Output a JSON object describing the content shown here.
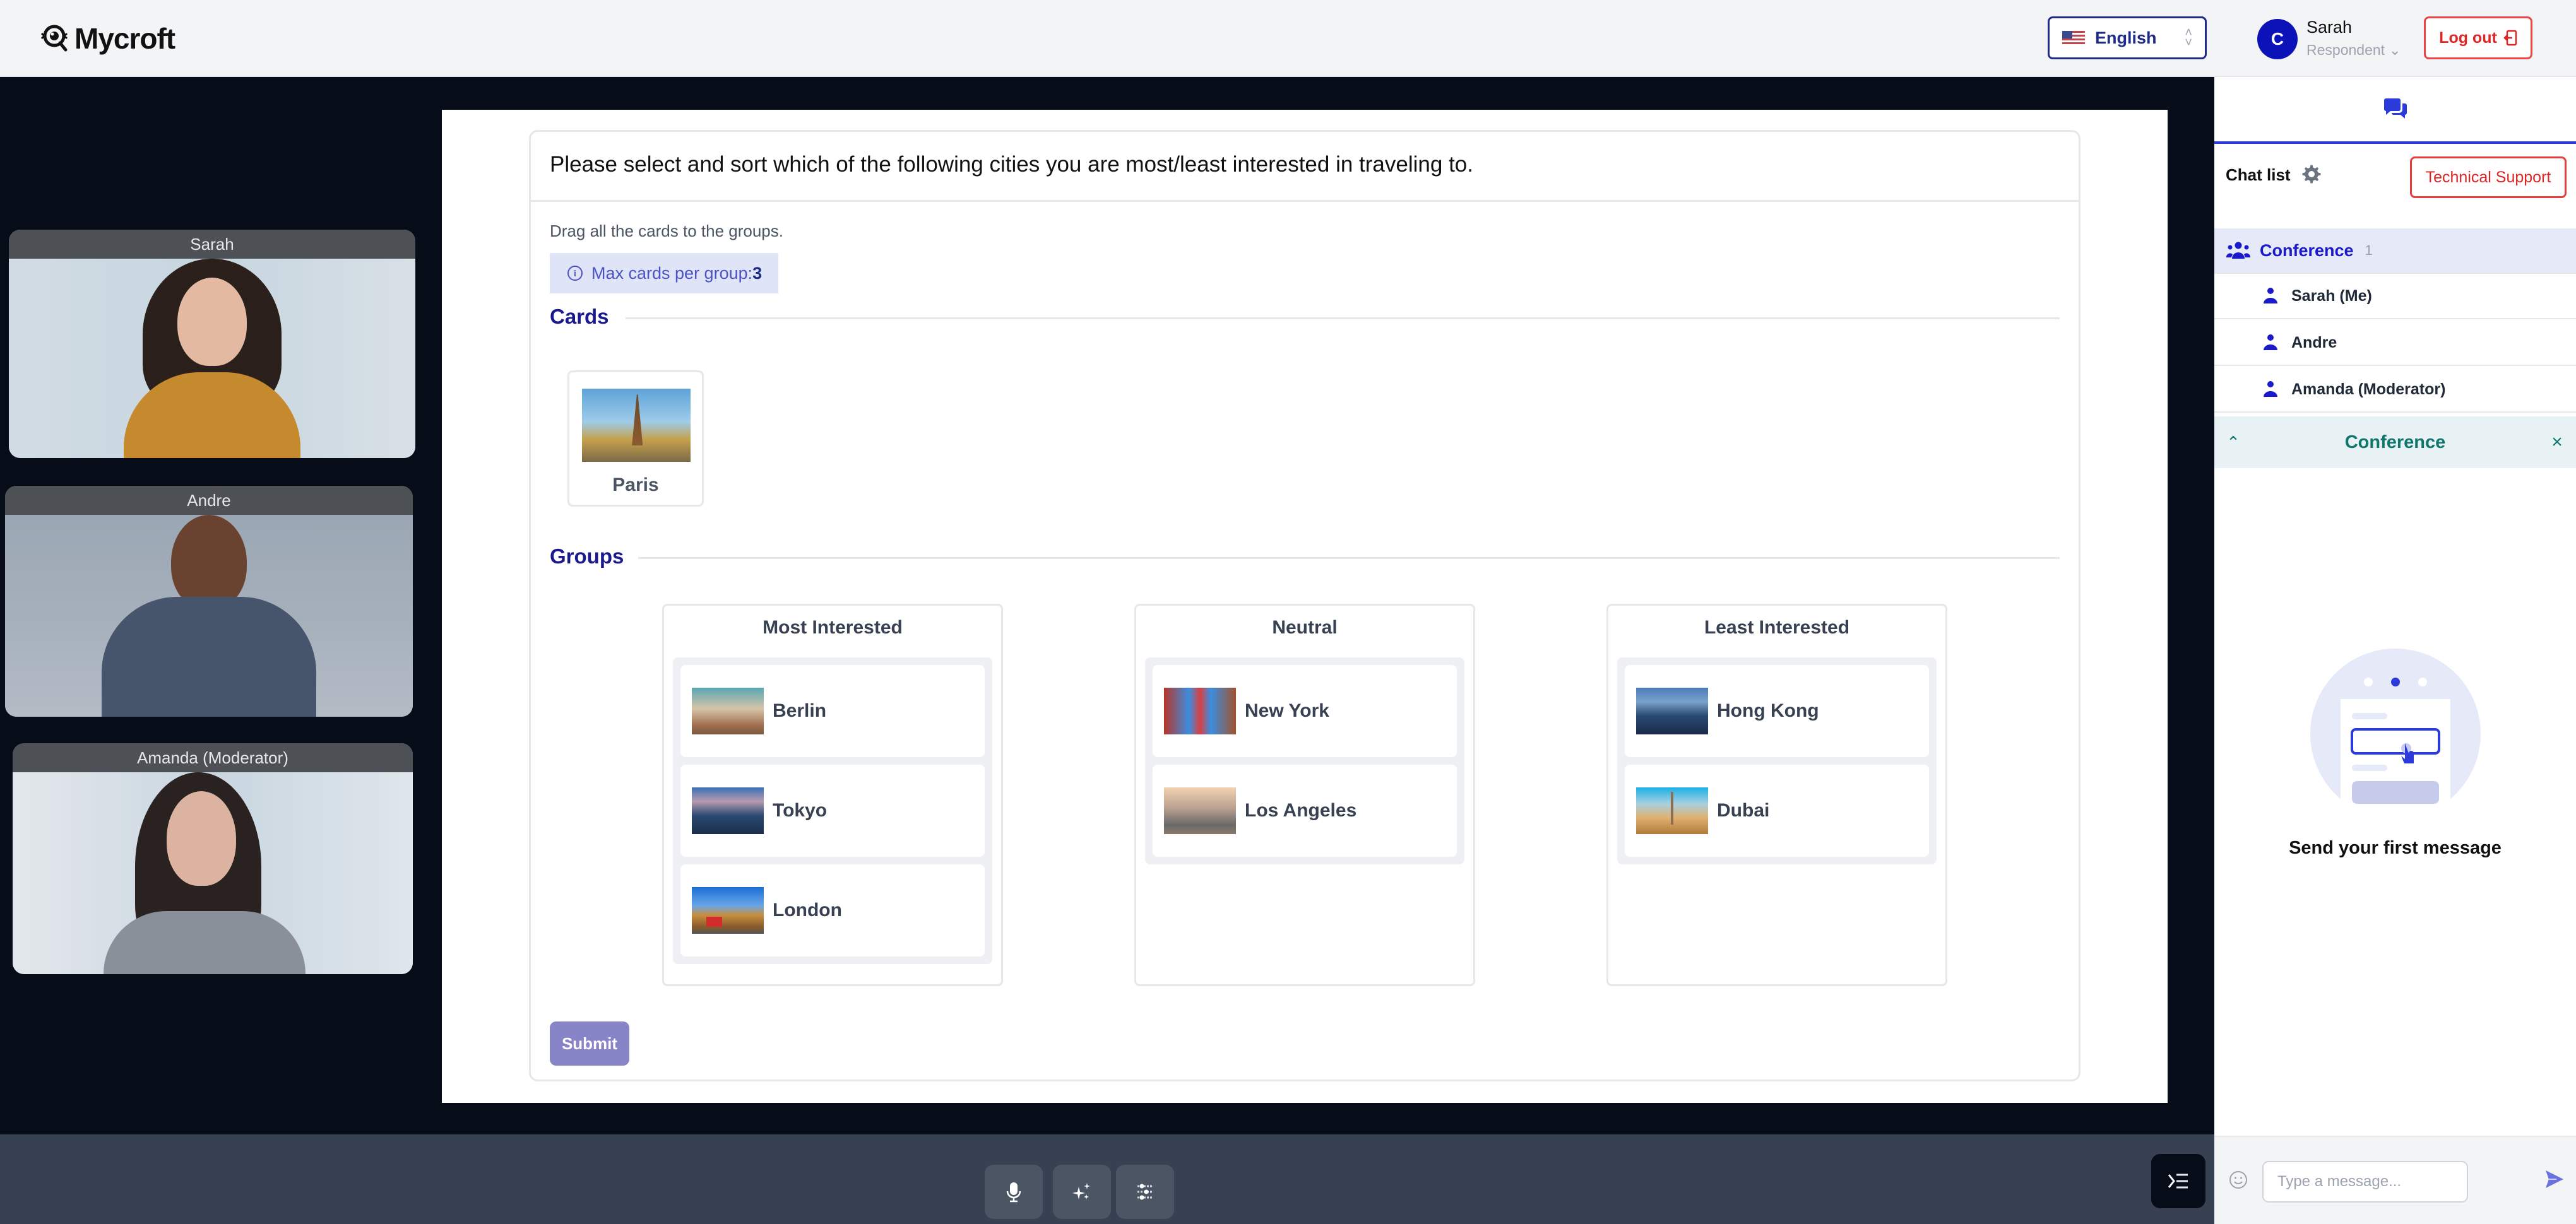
{
  "header": {
    "app_name": "Mycroft",
    "language": {
      "label": "English",
      "flag": "us-flag"
    },
    "user": {
      "initial": "C",
      "name": "Sarah",
      "role": "Respondent"
    },
    "logout_label": "Log out"
  },
  "video_tiles": [
    {
      "name": "Sarah"
    },
    {
      "name": "Andre"
    },
    {
      "name": "Amanda (Moderator)"
    }
  ],
  "survey": {
    "question": "Please select and sort which of the following cities you are most/least interested in traveling to.",
    "instruction": "Drag all the cards to the groups.",
    "max_info_label": "Max cards per group:",
    "max_info_value": "3",
    "cards_section_title": "Cards",
    "groups_section_title": "Groups",
    "unsorted_cards": [
      {
        "label": "Paris",
        "image": "eiffel-tower-photo"
      }
    ],
    "groups": [
      {
        "title": "Most Interested",
        "items": [
          {
            "label": "Berlin",
            "image": "berlin-skyline-photo"
          },
          {
            "label": "Tokyo",
            "image": "tokyo-skyline-photo"
          },
          {
            "label": "London",
            "image": "big-ben-photo"
          }
        ]
      },
      {
        "title": "Neutral",
        "items": [
          {
            "label": "New York",
            "image": "times-square-photo"
          },
          {
            "label": "Los Angeles",
            "image": "hollywood-street-photo"
          }
        ]
      },
      {
        "title": "Least Interested",
        "items": [
          {
            "label": "Hong Kong",
            "image": "hong-kong-skyline-photo"
          },
          {
            "label": "Dubai",
            "image": "burj-khalifa-photo"
          }
        ]
      }
    ],
    "submit_label": "Submit"
  },
  "chat": {
    "tab_icon": "chat-bubbles-icon",
    "list_label": "Chat list",
    "support_label": "Technical Support",
    "conference": {
      "label": "Conference",
      "count": "1"
    },
    "members": [
      {
        "label": "Sarah (Me)"
      },
      {
        "label": "Andre"
      },
      {
        "label": "Amanda (Moderator)"
      }
    ],
    "open_conversation": "Conference",
    "empty_state": "Send your first message",
    "input_placeholder": "Type a message..."
  },
  "controls": {
    "buttons": [
      "microphone-icon",
      "sparkles-icon",
      "sliders-icon"
    ],
    "menu_icon": "collapse-menu-icon"
  },
  "colors": {
    "brand_blue": "#1a1acc",
    "accent_red": "#dc2626",
    "submit": "#8884c8",
    "teal": "#0f766e"
  }
}
